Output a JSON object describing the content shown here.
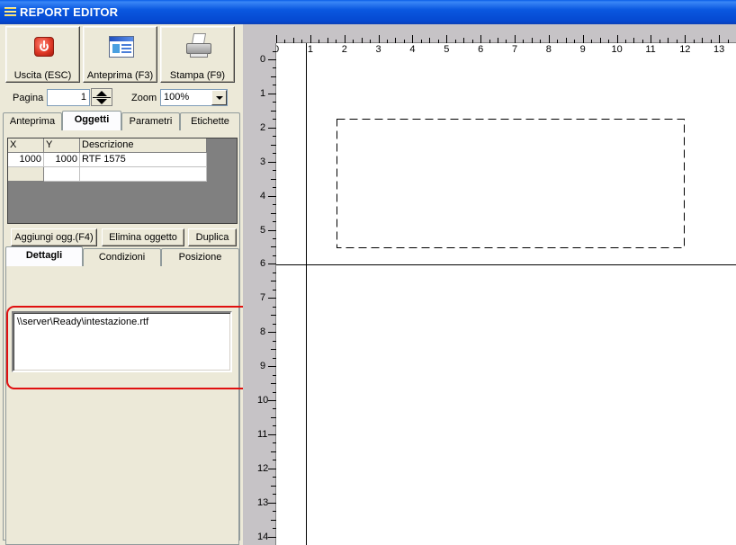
{
  "window": {
    "title": "REPORT EDITOR"
  },
  "toolbar": {
    "exit_label": "Uscita (ESC)",
    "preview_label": "Anteprima (F3)",
    "print_label": "Stampa (F9)"
  },
  "pager": {
    "page_label": "Pagina",
    "page_value": "1",
    "zoom_label": "Zoom",
    "zoom_value": "100%"
  },
  "tabs_top": [
    "Anteprima",
    "Oggetti",
    "Parametri",
    "Etichette"
  ],
  "active_tab_top": "Oggetti",
  "objects_table": {
    "headers": [
      "X",
      "Y",
      "Descrizione"
    ],
    "rows": [
      [
        "1000",
        "1000",
        "RTF 1575"
      ]
    ]
  },
  "object_buttons": {
    "add": "Aggiungi ogg.(F4)",
    "delete": "Elimina oggetto",
    "duplicate": "Duplica"
  },
  "tabs_detail": [
    "Dettagli",
    "Condizioni",
    "Posizione"
  ],
  "active_tab_detail": "Dettagli",
  "details": {
    "file_path": "\\\\server\\Ready\\intestazione.rtf"
  },
  "ruler": {
    "horizontal": [
      "0",
      "1",
      "2",
      "3",
      "4",
      "5",
      "6",
      "7",
      "8",
      "9",
      "10",
      "11",
      "12",
      "13"
    ],
    "vertical": [
      "0",
      "1",
      "2",
      "3",
      "4",
      "5",
      "6",
      "7",
      "8",
      "9",
      "10",
      "11",
      "12",
      "13",
      "14"
    ]
  },
  "colors": {
    "titlebar": "#0a58e0",
    "highlight": "#e01010",
    "face": "#ece9d8"
  }
}
